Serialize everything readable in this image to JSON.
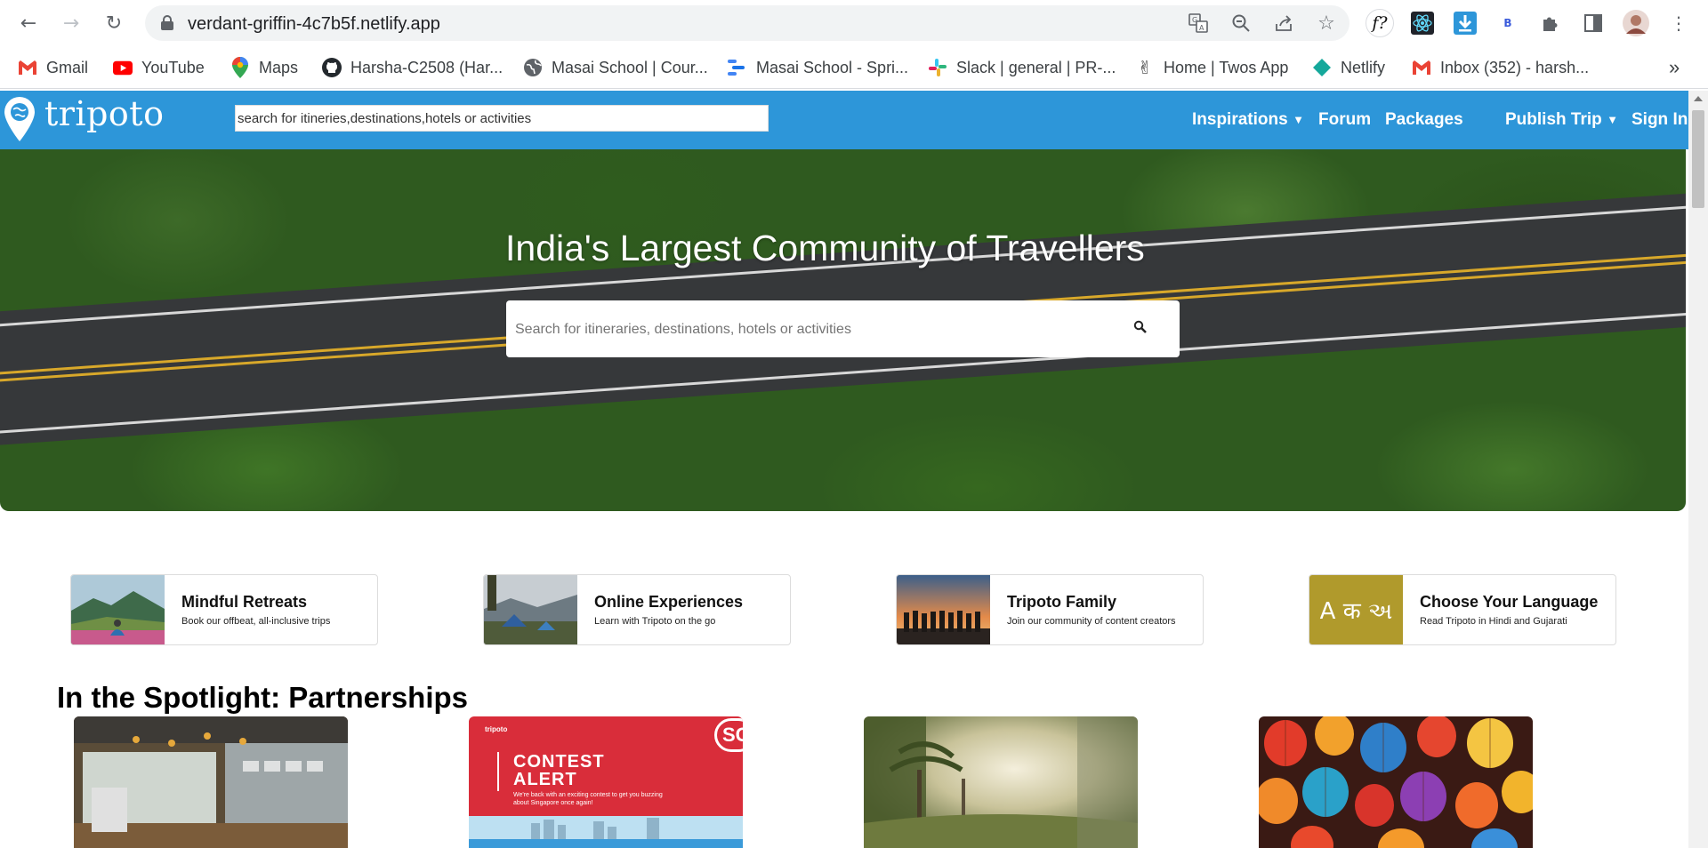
{
  "browser": {
    "url": "verdant-griffin-4c7b5f.netlify.app",
    "bookmarks": [
      {
        "label": "Gmail",
        "icon": "gmail-icon"
      },
      {
        "label": "YouTube",
        "icon": "youtube-icon"
      },
      {
        "label": "Maps",
        "icon": "maps-icon"
      },
      {
        "label": "Harsha-C2508 (Har...",
        "icon": "github-icon"
      },
      {
        "label": "Masai School | Cour...",
        "icon": "globe-icon"
      },
      {
        "label": "Masai School - Spri...",
        "icon": "sprint-icon"
      },
      {
        "label": "Slack | general | PR-...",
        "icon": "slack-icon"
      },
      {
        "label": "Home | Twos App",
        "icon": "twos-icon"
      },
      {
        "label": "Netlify",
        "icon": "netlify-icon"
      },
      {
        "label": "Inbox (352) - harsh...",
        "icon": "gmail-icon"
      }
    ],
    "more_bookmarks": "»",
    "ext_labels": {
      "fquestion": "f?",
      "bext": "B"
    }
  },
  "site": {
    "logo_text": "tripoto",
    "header_search_placeholder": "search for itineries,destinations,hotels or activities",
    "nav": {
      "inspirations": "Inspirations",
      "forum": "Forum",
      "packages": "Packages",
      "publish_trip": "Publish Trip",
      "sign_in": "Sign In"
    },
    "hero": {
      "title": "India's Largest Community of Travellers",
      "search_placeholder": "Search for itineraries, destinations, hotels or activities"
    },
    "cards": [
      {
        "title": "Mindful Retreats",
        "subtitle": "Book our offbeat, all-inclusive trips"
      },
      {
        "title": "Online Experiences",
        "subtitle": "Learn with Tripoto on the go"
      },
      {
        "title": "Tripoto Family",
        "subtitle": "Join our community of content creators"
      },
      {
        "title": "Choose Your Language",
        "subtitle": "Read Tripoto in Hindi and Gujarati",
        "thumb_text": "A क અ"
      }
    ],
    "spotlight_title": "In the Spotlight: Partnerships",
    "contest": {
      "brand": "tripoto",
      "badge": "SG",
      "line1": "CONTEST",
      "line2": "ALERT",
      "body": "We're back with an exciting contest to get you buzzing about Singapore once again!"
    }
  },
  "colors": {
    "brand_blue": "#2d96d9",
    "contest_red": "#d92d3a"
  }
}
